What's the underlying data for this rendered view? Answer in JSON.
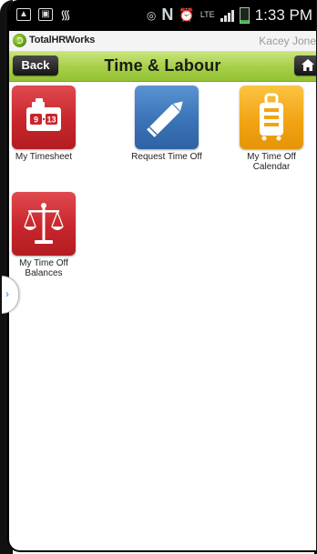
{
  "status_bar": {
    "time": "1:33 PM",
    "network_label": "LTE",
    "carrier_letter": "N"
  },
  "app_header": {
    "brand": "TotalHRWorks",
    "user_name": "Kacey Jones"
  },
  "title_bar": {
    "back_label": "Back",
    "title": "Time & Labour"
  },
  "tiles": [
    {
      "label": "My Timesheet",
      "icon": "timesheet-icon",
      "color": "#c7262c",
      "clock_left": "9",
      "clock_right": "13"
    },
    {
      "label": "Request Time Off",
      "icon": "pencil-icon",
      "color": "#3a73b7"
    },
    {
      "label": "My Time Off Calendar",
      "icon": "suitcase-icon",
      "color": "#f2a414"
    },
    {
      "label": "My Time Off Balances",
      "icon": "scales-icon",
      "color": "#c7262c"
    }
  ],
  "colors": {
    "accent_green": "#a8d04a",
    "dark_button": "#1a1a1a"
  }
}
